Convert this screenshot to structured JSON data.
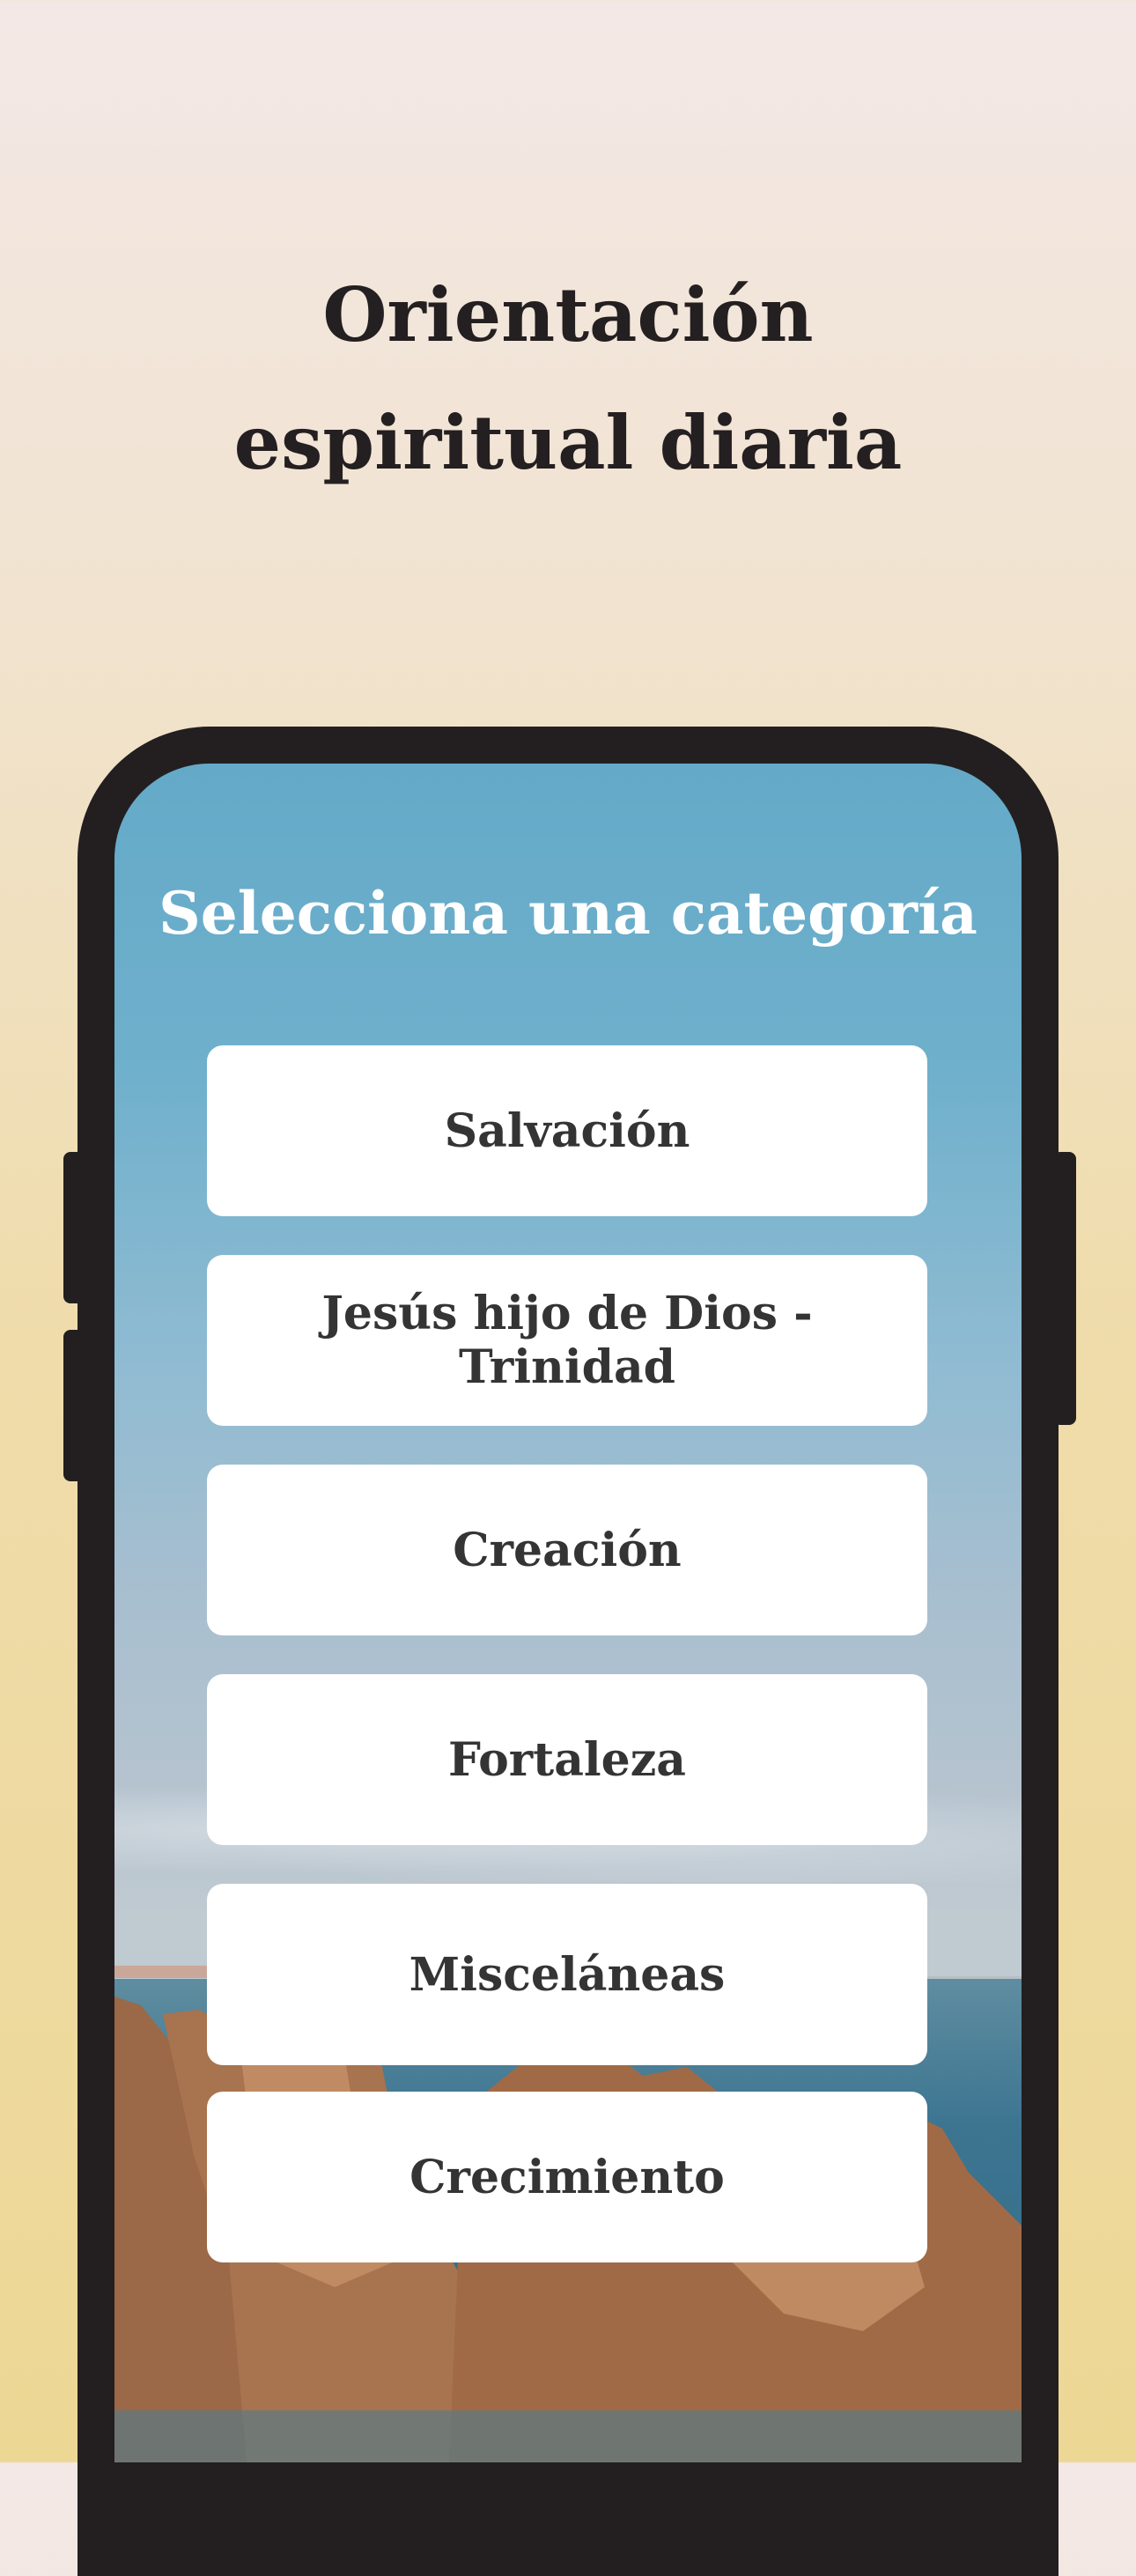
{
  "headline": {
    "line1": "Orientación",
    "line2": "espiritual diaria"
  },
  "screen": {
    "title": "Selecciona una categoría",
    "categories": [
      {
        "label": "Salvación"
      },
      {
        "label": "Jesús hijo de Dios - Trinidad"
      },
      {
        "label": "Creación"
      },
      {
        "label": "Fortaleza"
      },
      {
        "label": "Misceláneas"
      },
      {
        "label": "Crecimiento"
      }
    ]
  },
  "colors": {
    "phone_frame": "#231f20",
    "button_bg": "#ffffff",
    "button_text": "#343435",
    "headline_text": "#241f20"
  }
}
